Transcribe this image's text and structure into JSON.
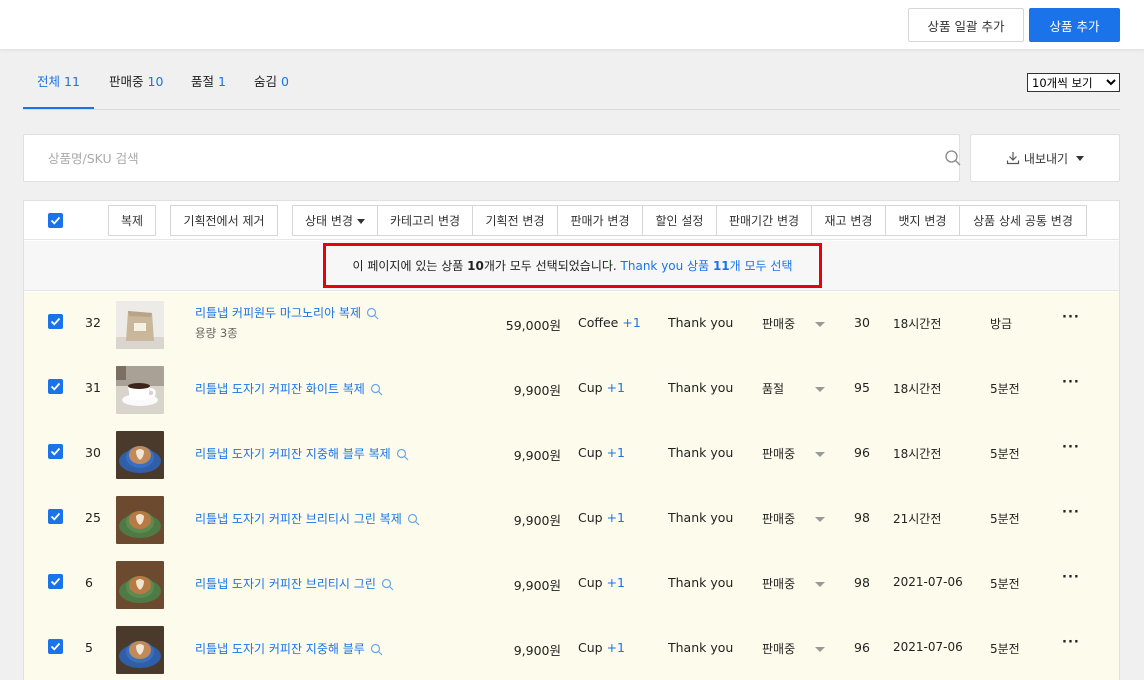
{
  "topbar": {
    "bulk_add_label": "상품 일괄 추가",
    "add_label": "상품 추가"
  },
  "tabs": [
    {
      "label": "전체",
      "count": "11",
      "active": true
    },
    {
      "label": "판매중",
      "count": "10"
    },
    {
      "label": "품절",
      "count": "1"
    },
    {
      "label": "숨김",
      "count": "0"
    }
  ],
  "per_page": {
    "selected": "10개씩 보기"
  },
  "search": {
    "placeholder": "상품명/SKU 검색"
  },
  "export": {
    "label": "내보내기"
  },
  "toolbar": {
    "buttons": [
      "복제",
      "기획전에서 제거",
      "상태 변경",
      "카테고리 변경",
      "기획전 변경",
      "판매가 변경",
      "할인 설정",
      "판매기간 변경",
      "재고 변경",
      "뱃지 변경",
      "상품 상세 공통 변경"
    ]
  },
  "notice": {
    "pre": "이 페이지에 있는 상품 ",
    "count": "10",
    "mid": "개가 모두 선택되었습니다. ",
    "link_pre": "Thank you 상품 ",
    "link_count": "11",
    "link_post": "개 모두 선택"
  },
  "colors": {
    "accent": "#1a73e8",
    "highlight": "#e8000b",
    "row_selected": "#fdfbeb"
  },
  "rows": [
    {
      "id": "32",
      "name": "리틀냅 커피원두 마그노리아 복제",
      "option": "용량 3종",
      "price": "59,000원",
      "category": "Coffee",
      "category_extra": "+1",
      "exhibition": "Thank you",
      "status": "판매중",
      "stock": "30",
      "created": "18시간전",
      "updated": "방금",
      "image": "coffee-bag"
    },
    {
      "id": "31",
      "name": "리틀냅 도자기 커피잔 화이트 복제",
      "option": "",
      "price": "9,900원",
      "category": "Cup",
      "category_extra": "+1",
      "exhibition": "Thank you",
      "status": "품절",
      "stock": "95",
      "created": "18시간전",
      "updated": "5분전",
      "image": "white-cup"
    },
    {
      "id": "30",
      "name": "리틀냅 도자기 커피잔 지중해 블루 복제",
      "option": "",
      "price": "9,900원",
      "category": "Cup",
      "category_extra": "+1",
      "exhibition": "Thank you",
      "status": "판매중",
      "stock": "96",
      "created": "18시간전",
      "updated": "5분전",
      "image": "blue-cup"
    },
    {
      "id": "25",
      "name": "리틀냅 도자기 커피잔 브리티시 그린 복제",
      "option": "",
      "price": "9,900원",
      "category": "Cup",
      "category_extra": "+1",
      "exhibition": "Thank you",
      "status": "판매중",
      "stock": "98",
      "created": "21시간전",
      "updated": "5분전",
      "image": "green-cup"
    },
    {
      "id": "6",
      "name": "리틀냅 도자기 커피잔 브리티시 그린",
      "option": "",
      "price": "9,900원",
      "category": "Cup",
      "category_extra": "+1",
      "exhibition": "Thank you",
      "status": "판매중",
      "stock": "98",
      "created": "2021-07-06",
      "updated": "5분전",
      "image": "green-cup"
    },
    {
      "id": "5",
      "name": "리틀냅 도자기 커피잔 지중해 블루",
      "option": "",
      "price": "9,900원",
      "category": "Cup",
      "category_extra": "+1",
      "exhibition": "Thank you",
      "status": "판매중",
      "stock": "96",
      "created": "2021-07-06",
      "updated": "5분전",
      "image": "blue-cup"
    }
  ]
}
